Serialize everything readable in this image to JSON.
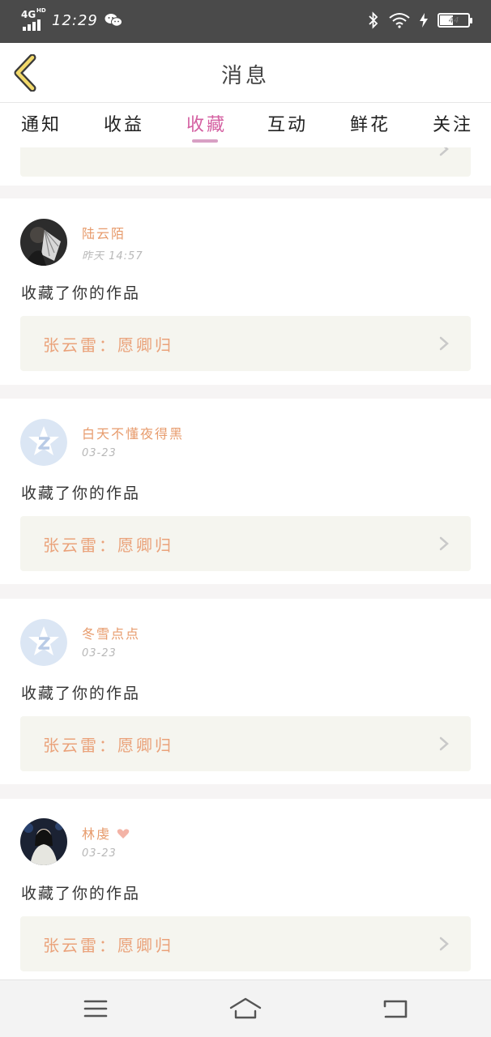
{
  "status_bar": {
    "network": "4G",
    "network_sup": "HD",
    "time": "12:29",
    "battery": "44",
    "icons": [
      "signal-icon",
      "wechat-icon",
      "bluetooth-icon",
      "wifi-icon",
      "charging-icon",
      "battery-icon"
    ]
  },
  "header": {
    "title": "消息",
    "back_icon": "chevron-left-icon"
  },
  "tabs": [
    {
      "label": "通知",
      "active": false
    },
    {
      "label": "收益",
      "active": false
    },
    {
      "label": "收藏",
      "active": true
    },
    {
      "label": "互动",
      "active": false
    },
    {
      "label": "鲜花",
      "active": false
    },
    {
      "label": "关注",
      "active": false
    }
  ],
  "feed": {
    "items": [
      {
        "user": "陆云陌",
        "time": "昨天 14:57",
        "action": "收藏了你的作品",
        "work_title": "张云雷：愿卿归",
        "avatar": "photo-dark-fan"
      },
      {
        "user": "白天不懂夜得黑",
        "time": "03-23",
        "action": "收藏了你的作品",
        "work_title": "张云雷：愿卿归",
        "avatar": "default-z-avatar"
      },
      {
        "user": "冬雪点点",
        "time": "03-23",
        "action": "收藏了你的作品",
        "work_title": "张云雷：愿卿归",
        "avatar": "default-z-avatar"
      },
      {
        "user": "林虔",
        "time": "03-23",
        "action": "收藏了你的作品",
        "work_title": "张云雷：愿卿归",
        "avatar": "photo-girl-night"
      }
    ]
  },
  "navbar": {
    "icons": [
      "menu-icon",
      "home-icon",
      "back-icon"
    ]
  },
  "colors": {
    "accent_pink": "#d45fa1",
    "name_orange": "#e79b6c",
    "work_bg": "#f5f5ef",
    "statusbar_bg": "#4a4a4a"
  }
}
